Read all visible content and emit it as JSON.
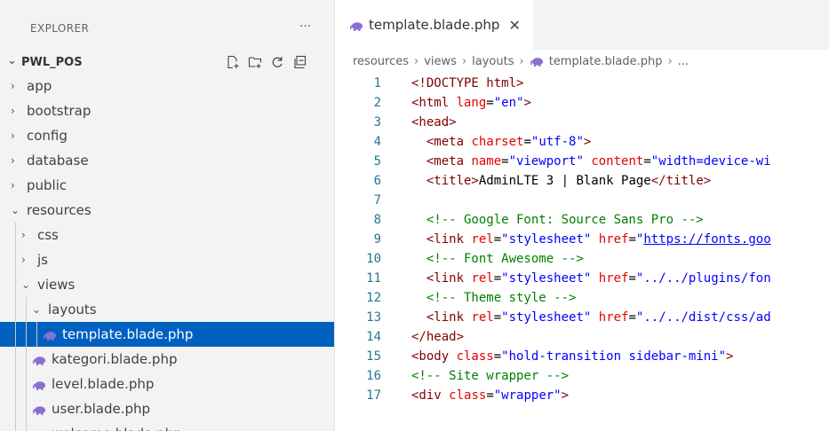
{
  "sidebar": {
    "title": "EXPLORER",
    "more": "···",
    "project": "PWL_POS",
    "actions": [
      "new-file-icon",
      "new-folder-icon",
      "refresh-icon",
      "collapse-all-icon"
    ],
    "items": [
      {
        "label": "app",
        "chev": "›",
        "indent": 0,
        "type": "folder",
        "expanded": false
      },
      {
        "label": "bootstrap",
        "chev": "›",
        "indent": 0,
        "type": "folder",
        "expanded": false
      },
      {
        "label": "config",
        "chev": "›",
        "indent": 0,
        "type": "folder",
        "expanded": false
      },
      {
        "label": "database",
        "chev": "›",
        "indent": 0,
        "type": "folder",
        "expanded": false
      },
      {
        "label": "public",
        "chev": "›",
        "indent": 0,
        "type": "folder",
        "expanded": false
      },
      {
        "label": "resources",
        "chev": "⌄",
        "indent": 0,
        "type": "folder",
        "expanded": true
      },
      {
        "label": "css",
        "chev": "›",
        "indent": 1,
        "type": "folder",
        "expanded": false
      },
      {
        "label": "js",
        "chev": "›",
        "indent": 1,
        "type": "folder",
        "expanded": false
      },
      {
        "label": "views",
        "chev": "⌄",
        "indent": 1,
        "type": "folder",
        "expanded": true
      },
      {
        "label": "layouts",
        "chev": "⌄",
        "indent": 2,
        "type": "folder",
        "expanded": true
      },
      {
        "label": "template.blade.php",
        "chev": "",
        "indent": 3,
        "type": "file",
        "selected": true
      },
      {
        "label": "kategori.blade.php",
        "chev": "",
        "indent": 2,
        "type": "file"
      },
      {
        "label": "level.blade.php",
        "chev": "",
        "indent": 2,
        "type": "file"
      },
      {
        "label": "user.blade.php",
        "chev": "",
        "indent": 2,
        "type": "file"
      },
      {
        "label": "welcome.blade.php",
        "chev": "",
        "indent": 2,
        "type": "file"
      }
    ]
  },
  "editor": {
    "tab": {
      "label": "template.blade.php",
      "close": "✕"
    },
    "breadcrumb": [
      "resources",
      "views",
      "layouts",
      "template.blade.php",
      "..."
    ],
    "lines": [
      {
        "n": "1",
        "tokens": [
          [
            "tag",
            "<!DOCTYPE html>"
          ]
        ]
      },
      {
        "n": "2",
        "tokens": [
          [
            "tag",
            "<html "
          ],
          [
            "attr",
            "lang"
          ],
          [
            "txt",
            "="
          ],
          [
            "val",
            "\"en\""
          ],
          [
            "tag",
            ">"
          ]
        ]
      },
      {
        "n": "3",
        "tokens": [
          [
            "tag",
            "<head>"
          ]
        ]
      },
      {
        "n": "4",
        "tokens": [
          [
            "txt",
            "  "
          ],
          [
            "tag",
            "<meta "
          ],
          [
            "attr",
            "charset"
          ],
          [
            "txt",
            "="
          ],
          [
            "val",
            "\"utf-8\""
          ],
          [
            "tag",
            ">"
          ]
        ]
      },
      {
        "n": "5",
        "tokens": [
          [
            "txt",
            "  "
          ],
          [
            "tag",
            "<meta "
          ],
          [
            "attr",
            "name"
          ],
          [
            "txt",
            "="
          ],
          [
            "val",
            "\"viewport\""
          ],
          [
            "txt",
            " "
          ],
          [
            "attr",
            "content"
          ],
          [
            "txt",
            "="
          ],
          [
            "val",
            "\"width=device-wi"
          ]
        ]
      },
      {
        "n": "6",
        "tokens": [
          [
            "txt",
            "  "
          ],
          [
            "tag",
            "<title>"
          ],
          [
            "txt",
            "AdminLTE 3 | Blank Page"
          ],
          [
            "tag",
            "</title>"
          ]
        ]
      },
      {
        "n": "7",
        "tokens": []
      },
      {
        "n": "8",
        "tokens": [
          [
            "txt",
            "  "
          ],
          [
            "comment",
            "<!-- Google Font: Source Sans Pro -->"
          ]
        ]
      },
      {
        "n": "9",
        "tokens": [
          [
            "txt",
            "  "
          ],
          [
            "tag",
            "<link "
          ],
          [
            "attr",
            "rel"
          ],
          [
            "txt",
            "="
          ],
          [
            "val",
            "\"stylesheet\""
          ],
          [
            "txt",
            " "
          ],
          [
            "attr",
            "href"
          ],
          [
            "txt",
            "="
          ],
          [
            "val",
            "\""
          ],
          [
            "link",
            "https://fonts.goo"
          ]
        ]
      },
      {
        "n": "10",
        "tokens": [
          [
            "txt",
            "  "
          ],
          [
            "comment",
            "<!-- Font Awesome -->"
          ]
        ]
      },
      {
        "n": "11",
        "tokens": [
          [
            "txt",
            "  "
          ],
          [
            "tag",
            "<link "
          ],
          [
            "attr",
            "rel"
          ],
          [
            "txt",
            "="
          ],
          [
            "val",
            "\"stylesheet\""
          ],
          [
            "txt",
            " "
          ],
          [
            "attr",
            "href"
          ],
          [
            "txt",
            "="
          ],
          [
            "val",
            "\"../../plugins/fon"
          ]
        ]
      },
      {
        "n": "12",
        "tokens": [
          [
            "txt",
            "  "
          ],
          [
            "comment",
            "<!-- Theme style -->"
          ]
        ]
      },
      {
        "n": "13",
        "tokens": [
          [
            "txt",
            "  "
          ],
          [
            "tag",
            "<link "
          ],
          [
            "attr",
            "rel"
          ],
          [
            "txt",
            "="
          ],
          [
            "val",
            "\"stylesheet\""
          ],
          [
            "txt",
            " "
          ],
          [
            "attr",
            "href"
          ],
          [
            "txt",
            "="
          ],
          [
            "val",
            "\"../../dist/css/ad"
          ]
        ]
      },
      {
        "n": "14",
        "tokens": [
          [
            "tag",
            "</head>"
          ]
        ]
      },
      {
        "n": "15",
        "tokens": [
          [
            "tag",
            "<body "
          ],
          [
            "attr",
            "class"
          ],
          [
            "txt",
            "="
          ],
          [
            "val",
            "\"hold-transition sidebar-mini\""
          ],
          [
            "tag",
            ">"
          ]
        ]
      },
      {
        "n": "16",
        "tokens": [
          [
            "comment",
            "<!-- Site wrapper -->"
          ]
        ]
      },
      {
        "n": "17",
        "tokens": [
          [
            "tag",
            "<div "
          ],
          [
            "attr",
            "class"
          ],
          [
            "txt",
            "="
          ],
          [
            "val",
            "\"wrapper\""
          ],
          [
            "tag",
            ">"
          ]
        ]
      }
    ]
  }
}
